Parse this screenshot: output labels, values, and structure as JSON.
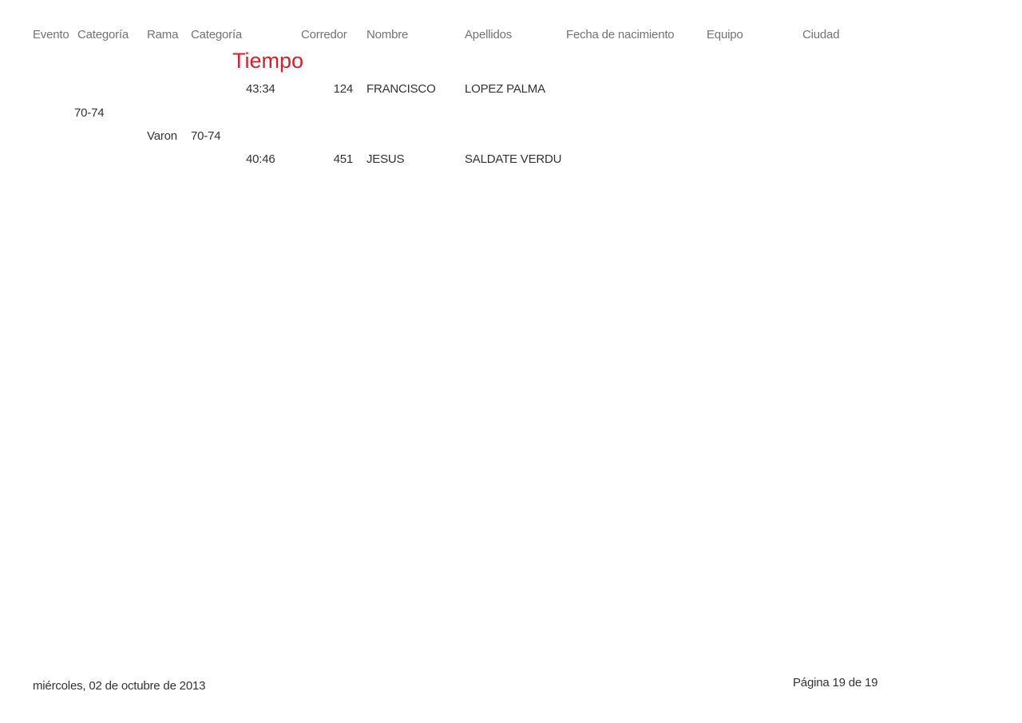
{
  "header": {
    "evento": "Evento",
    "categoria1": "Categoría",
    "rama": "Rama",
    "categoria2": "Categoría",
    "corredor": "Corredor",
    "nombre": "Nombre",
    "apellidos": "Apellidos",
    "fecha_nacimiento": "Fecha de nacimiento",
    "equipo": "Equipo",
    "ciudad": "Ciudad",
    "tiempo": "Tiempo"
  },
  "rows": [
    {
      "tiempo": "43:34",
      "corredor": "124",
      "nombre": "FRANCISCO",
      "apellidos": "LOPEZ PALMA"
    },
    {
      "tiempo": "40:46",
      "corredor": "451",
      "nombre": "JESUS",
      "apellidos": "SALDATE VERDU"
    }
  ],
  "groups": {
    "categoria": "70-74",
    "rama": "Varon",
    "categoria_rama": "70-74"
  },
  "footer": {
    "date": "miércoles, 02 de octubre de 2013",
    "page": "Página 19 de 19"
  }
}
